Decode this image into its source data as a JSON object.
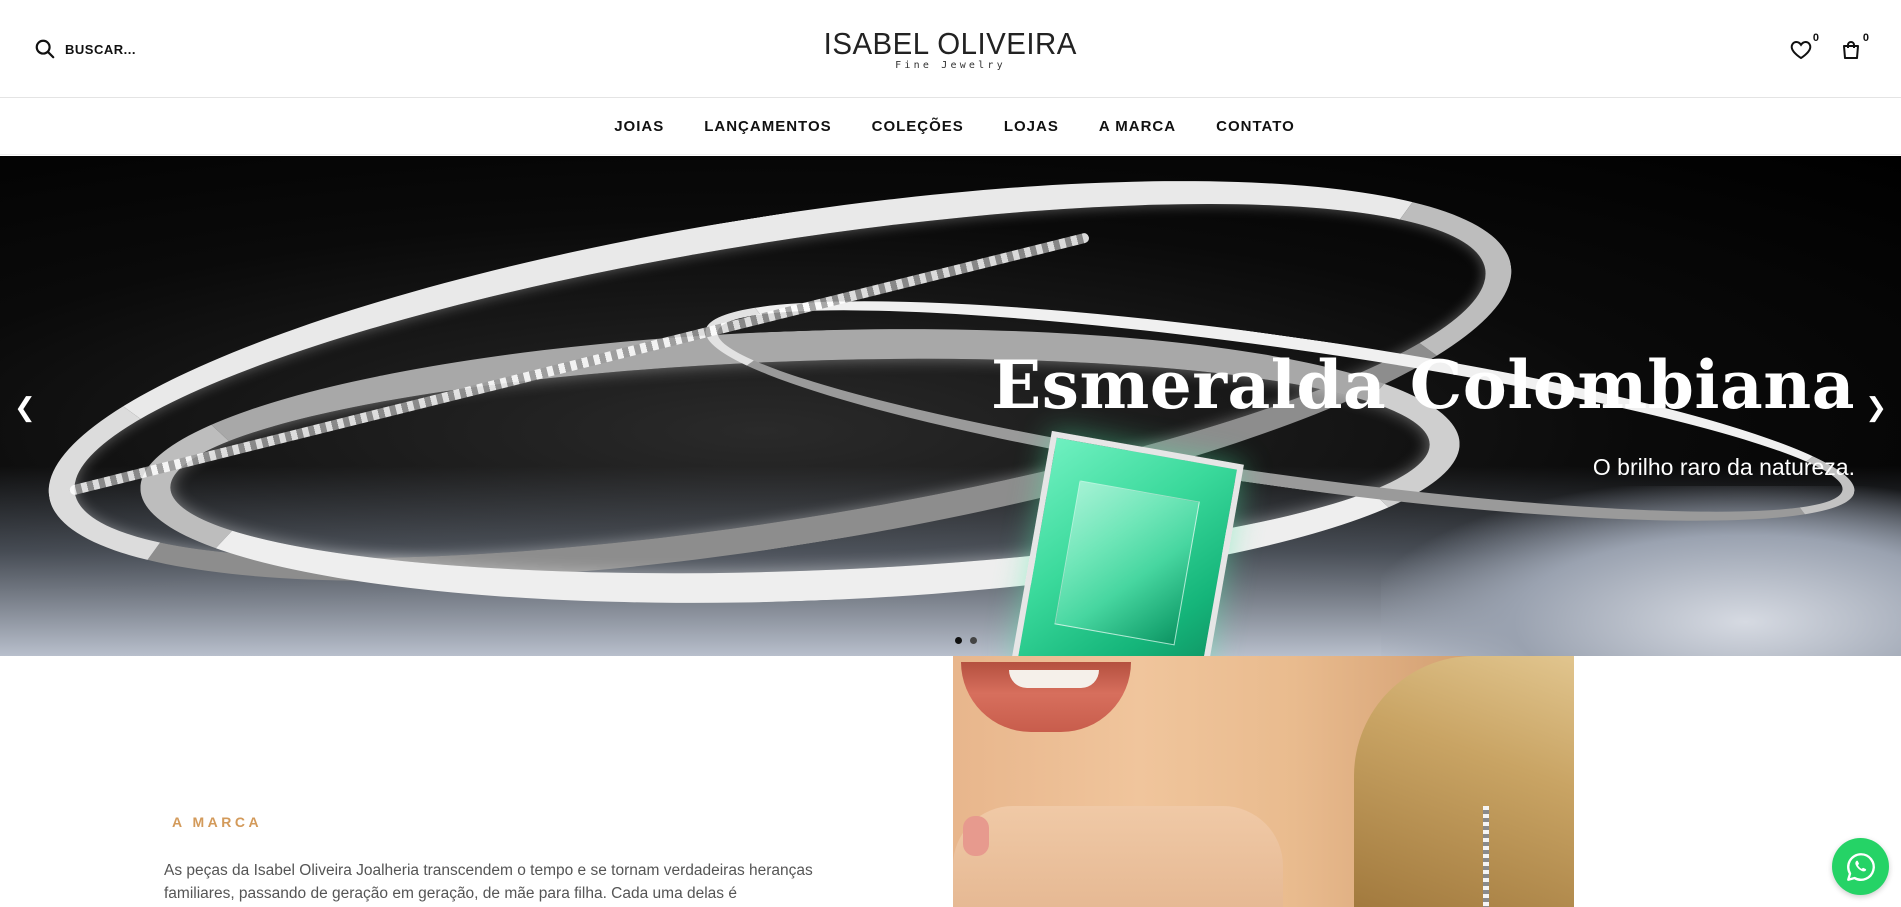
{
  "header": {
    "search_label": "BUSCAR...",
    "logo_name": "ISABEL OLIVEIRA",
    "logo_tagline": "Fine Jewelry",
    "wishlist_count": "0",
    "cart_count": "0"
  },
  "nav": {
    "items": [
      {
        "label": "JOIAS"
      },
      {
        "label": "LANÇAMENTOS"
      },
      {
        "label": "COLEÇÕES"
      },
      {
        "label": "LOJAS"
      },
      {
        "label": "A MARCA"
      },
      {
        "label": "CONTATO"
      }
    ]
  },
  "hero": {
    "title": "Esmeralda Colombiana",
    "subtitle": "O brilho raro da natureza.",
    "prev_icon": "chevron-left-icon",
    "next_icon": "chevron-right-icon",
    "slide_count": 2,
    "active_slide": 1
  },
  "brand": {
    "eyebrow": "A MARCA",
    "text": "As peças da Isabel Oliveira Joalheria transcendem o tempo e se tornam verdadeiras heranças familiares, passando de geração em geração, de mãe para filha. Cada uma delas é"
  },
  "floating": {
    "whatsapp_icon": "whatsapp-icon"
  },
  "colors": {
    "accent": "#d39a5a",
    "whatsapp": "#25d366",
    "text": "#111111"
  }
}
